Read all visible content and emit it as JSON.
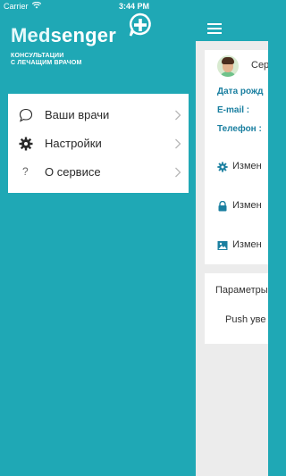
{
  "status_bar": {
    "carrier": "Carrier",
    "time": "3:44 PM"
  },
  "logo": {
    "word_part1": "Med",
    "word_part2": "senger",
    "tagline_line1": "КОНСУЛЬТАЦИИ",
    "tagline_line2": "С ЛЕЧАЩИМ ВРАЧОМ"
  },
  "menu": {
    "items": [
      {
        "label": "Ваши врачи",
        "icon": "chat-bubble-icon"
      },
      {
        "label": "Настройки",
        "icon": "gear-icon"
      },
      {
        "label": "О сервисе",
        "icon": "question-icon",
        "glyph": "?"
      }
    ]
  },
  "profile": {
    "name_partial": "Сер",
    "birth_date_label": "Дата рожд",
    "email_label": "E-mail :",
    "phone_label": "Телефон :",
    "actions": [
      {
        "label": "Измен",
        "icon": "gear-icon"
      },
      {
        "label": "Измен",
        "icon": "lock-icon"
      },
      {
        "label": "Измен",
        "icon": "image-icon"
      }
    ]
  },
  "settings_card": {
    "title": "Параметры",
    "push_label": "Push уве"
  },
  "colors": {
    "accent": "#1fa8b5",
    "label_blue": "#1a7fa0"
  }
}
